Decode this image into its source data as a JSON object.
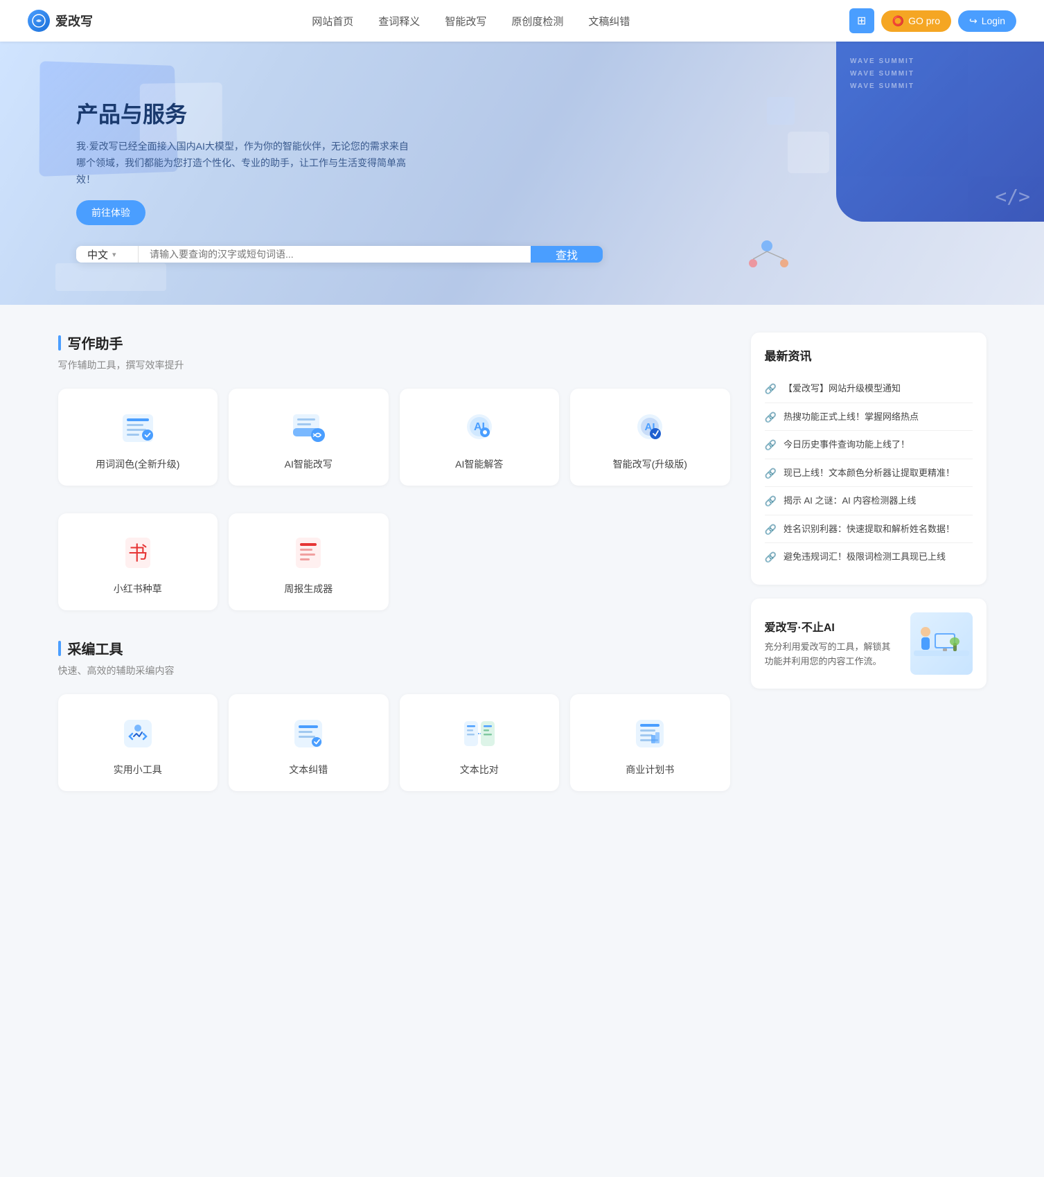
{
  "navbar": {
    "logo_icon": "改",
    "logo_text": "爱改写",
    "nav_items": [
      {
        "label": "网站首页",
        "href": "#"
      },
      {
        "label": "查词释义",
        "href": "#"
      },
      {
        "label": "智能改写",
        "href": "#"
      },
      {
        "label": "原创度检测",
        "href": "#"
      },
      {
        "label": "文稿纠错",
        "href": "#"
      }
    ],
    "btn_grid_icon": "⊞",
    "btn_go_pro": "GO pro",
    "btn_login": "Login"
  },
  "hero": {
    "title": "产品与服务",
    "desc": "我·爱改写已经全面接入国内AI大模型，作为你的智能伙伴，无论您的需求来自哪个领域，我们都能为您打造个性化、专业的助手，让工作与生活变得简单高效！",
    "btn_try": "前往体验",
    "wave_text": "WAVE SUMMIT"
  },
  "search": {
    "lang": "中文",
    "placeholder": "请输入要查询的汉字或短句词语...",
    "btn_label": "查找",
    "chevron": "▾"
  },
  "writing_section": {
    "title": "写作助手",
    "subtitle": "写作辅助工具，撰写效率提升",
    "tools": [
      {
        "label": "用词润色(全新升级)",
        "icon": "writing"
      },
      {
        "label": "AI智能改写",
        "icon": "ai_rewrite"
      },
      {
        "label": "AI智能解答",
        "icon": "ai_answer"
      },
      {
        "label": "智能改写(升级版)",
        "icon": "ai_upgrade"
      }
    ],
    "tools_row2": [
      {
        "label": "小红书种草",
        "icon": "book_red"
      },
      {
        "label": "周报生成器",
        "icon": "doc_red"
      }
    ]
  },
  "caipian_section": {
    "title": "采编工具",
    "subtitle": "快速、高效的辅助采编内容",
    "tools": [
      {
        "label": "实用小工具",
        "icon": "tools"
      },
      {
        "label": "文本纠错",
        "icon": "text_correct"
      },
      {
        "label": "文本比对",
        "icon": "text_compare"
      },
      {
        "label": "商业计划书",
        "icon": "business_plan"
      }
    ]
  },
  "news": {
    "title": "最新资讯",
    "items": [
      {
        "text": "【爱改写】网站升级模型通知"
      },
      {
        "text": "热搜功能正式上线！掌握网络热点"
      },
      {
        "text": "今日历史事件查询功能上线了！"
      },
      {
        "text": "现已上线！文本颜色分析器让提取更精准！"
      },
      {
        "text": "揭示 AI 之谜：AI 内容检测器上线"
      },
      {
        "text": "姓名识别利器：快速提取和解析姓名数据！"
      },
      {
        "text": "避免违规词汇！极限词检测工具现已上线"
      }
    ]
  },
  "promo": {
    "title": "爱改写·不止AI",
    "desc": "充分利用爱改写的工具，解锁其功能并利用您的内容工作流。",
    "figure_icon": "💻"
  }
}
